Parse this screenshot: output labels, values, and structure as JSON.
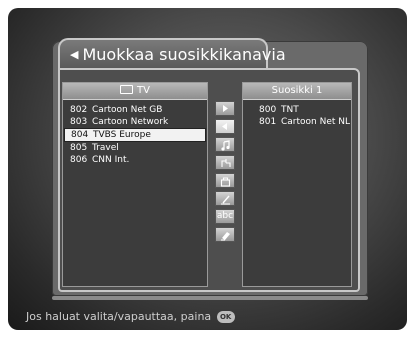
{
  "title": "Muokkaa suosikkikanavia",
  "left_panel": {
    "header": "TV",
    "channels": [
      {
        "num": "802",
        "name": "Cartoon Net GB"
      },
      {
        "num": "803",
        "name": "Cartoon Network"
      },
      {
        "num": "804",
        "name": "TVBS Europe"
      },
      {
        "num": "805",
        "name": "Travel"
      },
      {
        "num": "806",
        "name": "CNN Int."
      }
    ]
  },
  "right_panel": {
    "header": "Suosikki 1",
    "channels": [
      {
        "num": "800",
        "name": "TNT"
      },
      {
        "num": "801",
        "name": "Cartoon Net NL"
      }
    ]
  },
  "buttons": {
    "abc_label": "abc"
  },
  "footer": {
    "hint": "Jos haluat valita/vapauttaa, paina",
    "ok_label": "OK"
  }
}
